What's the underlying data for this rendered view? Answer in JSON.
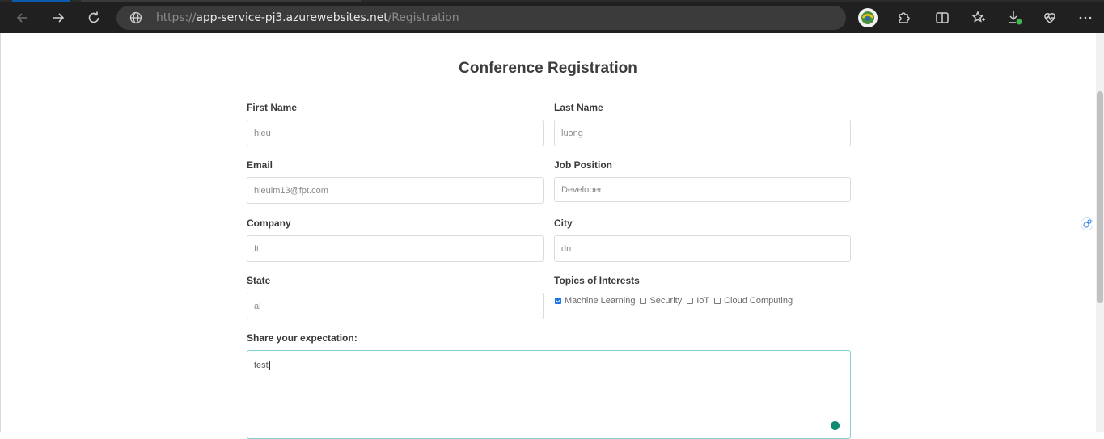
{
  "browser": {
    "url_prefix": "https://",
    "url_host": "app-service-pj3.azurewebsites.net",
    "url_path": "/Registration"
  },
  "form": {
    "title": "Conference Registration",
    "first_name": {
      "label": "First Name",
      "value": "hieu"
    },
    "last_name": {
      "label": "Last Name",
      "value": "luong"
    },
    "email": {
      "label": "Email",
      "value": "hieulm13@fpt.com"
    },
    "job_position": {
      "label": "Job Position",
      "value": "Developer"
    },
    "company": {
      "label": "Company",
      "value": "ft"
    },
    "city": {
      "label": "City",
      "value": "dn"
    },
    "state": {
      "label": "State",
      "value": "al"
    },
    "topics": {
      "label": "Topics of Interests",
      "options": [
        {
          "label": "Machine Learning",
          "checked": true
        },
        {
          "label": "Security",
          "checked": false
        },
        {
          "label": "IoT",
          "checked": false
        },
        {
          "label": "Cloud Computing",
          "checked": false
        }
      ]
    },
    "expectation": {
      "label": "Share your expectation:",
      "value": "test"
    }
  },
  "colors": {
    "browser_bar": "#202020",
    "address_bar": "#3b3b3b",
    "focus_border": "#7fcfd6",
    "checkbox_checked": "#1a73e8"
  }
}
